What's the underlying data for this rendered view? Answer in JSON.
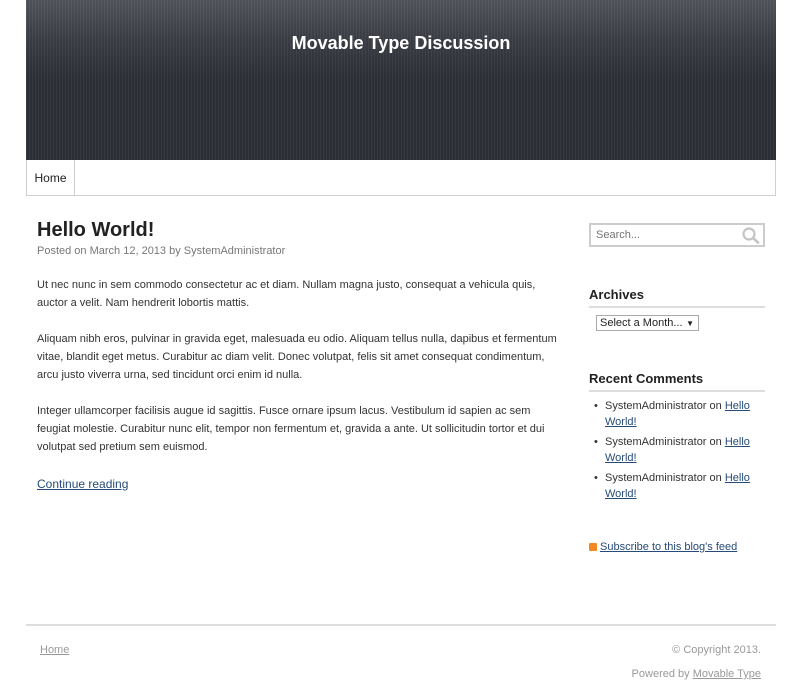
{
  "site": {
    "title": "Movable Type Discussion"
  },
  "nav": {
    "items": [
      {
        "label": "Home"
      }
    ]
  },
  "post": {
    "title": "Hello World!",
    "meta_prefix": "Posted on",
    "date": "March 12, 2013",
    "by": "by",
    "author": "SystemAdministrator",
    "paragraphs": [
      "Ut nec nunc in sem commodo consectetur ac et diam. Nullam magna justo, consequat a vehicula quis, auctor a velit. Nam hendrerit lobortis mattis.",
      " Aliquam nibh eros, pulvinar in gravida eget, malesuada eu odio. Aliquam tellus nulla, dapibus et fermentum vitae, blandit eget metus. Curabitur ac diam velit. Donec volutpat, felis sit amet consequat condimentum, arcu justo viverra urna, sed tincidunt orci enim id nulla.",
      "Integer ullamcorper facilisis augue id sagittis. Fusce ornare ipsum lacus. Vestibulum id sapien ac sem feugiat molestie. Curabitur nunc elit, tempor non fermentum et, gravida a ante. Ut sollicitudin tortor et dui volutpat sed pretium sem euismod."
    ],
    "continue_label": "Continue reading"
  },
  "sidebar": {
    "search": {
      "placeholder": "Search...",
      "icon": "search-icon"
    },
    "archives": {
      "title": "Archives",
      "select_value": "Select a Month..."
    },
    "recent_comments": {
      "title": "Recent Comments",
      "items": [
        {
          "author": "SystemAdministrator",
          "on": "on",
          "link": "Hello World!"
        },
        {
          "author": "SystemAdministrator",
          "on": "on",
          "link": "Hello World!"
        },
        {
          "author": "SystemAdministrator",
          "on": "on",
          "link": "Hello World!"
        }
      ]
    },
    "feed": {
      "label": "Subscribe to this blog's feed",
      "icon": "rss-icon",
      "icon_color": "#f28a21"
    }
  },
  "footer": {
    "home_label": "Home",
    "copyright": "© Copyright 2013.",
    "powered_prefix": "Powered by",
    "powered_link": "Movable Type"
  },
  "colors": {
    "header_bg": "#2b2e35",
    "link": "#264b78"
  }
}
